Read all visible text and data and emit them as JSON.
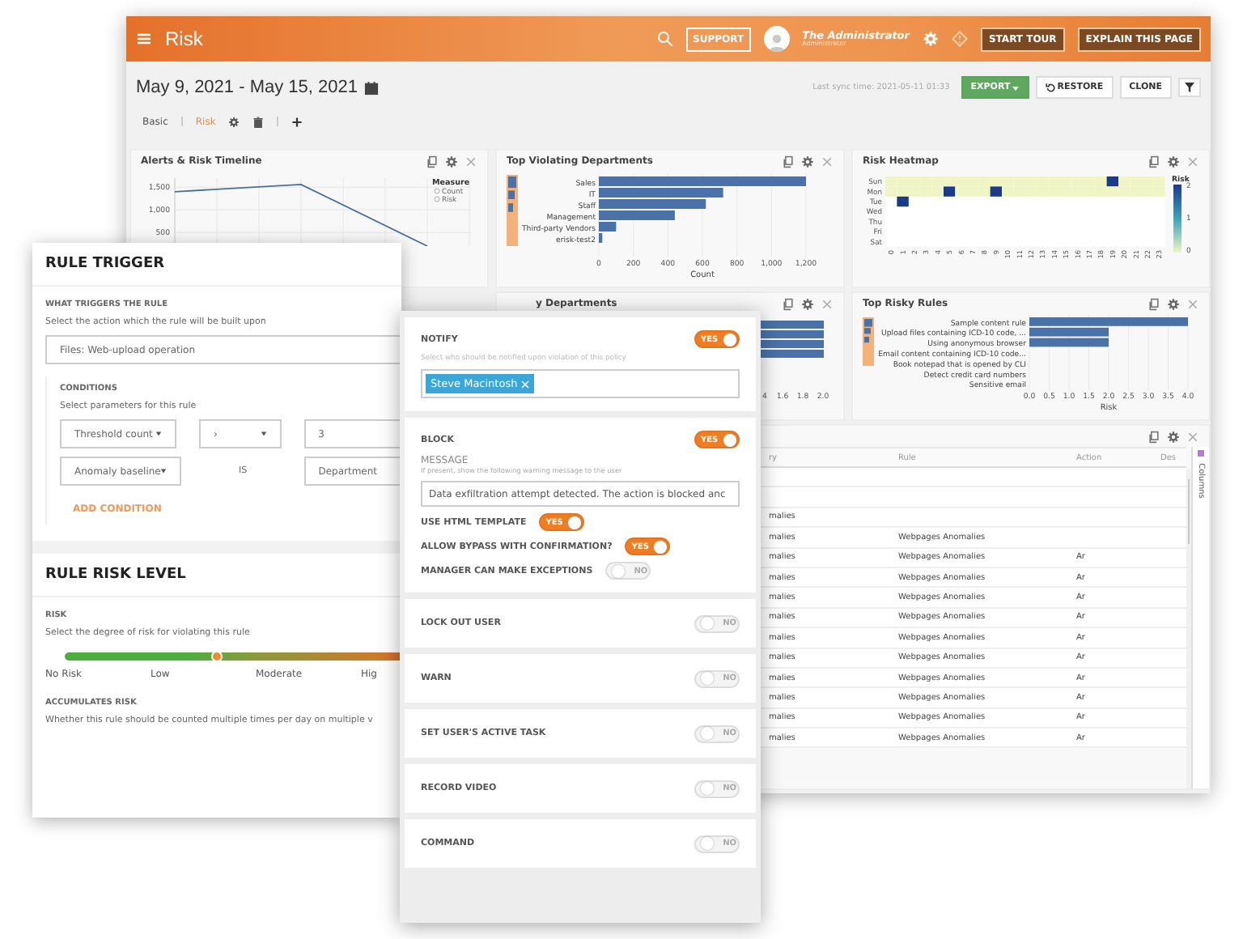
{
  "main_window": {
    "header": {
      "title": "Risk",
      "support": "SUPPORT",
      "user_name": "The Administrator",
      "user_role": "Administrator",
      "buttons": [
        "START TOUR",
        "EXPLAIN THIS PAGE"
      ]
    },
    "date_range": "May 9, 2021 - May 15, 2021",
    "last_sync": "Last sync time: 2021-05-11 01:33",
    "actions": [
      {
        "label": "EXPORT",
        "kind": "export"
      },
      {
        "label": "RESTORE",
        "kind": "restore"
      },
      {
        "label": "CLONE",
        "kind": "plain"
      }
    ],
    "tabs": [
      {
        "label": "Basic",
        "selected": false
      },
      {
        "label": "Risk",
        "selected": true
      }
    ],
    "alerts_timeline": {
      "title": "Alerts & Risk Timeline",
      "legend_title": "Measure",
      "legend": [
        "Count",
        "Risk"
      ],
      "chart_data": {
        "type": "line",
        "values": [
          1400,
          1560,
          200
        ],
        "ylim": [
          200,
          1700
        ],
        "yticks": [
          {
            "value": 500,
            "label": "500"
          },
          {
            "value": 1000,
            "label": "1,000"
          },
          {
            "value": 1500,
            "label": "1,500"
          }
        ],
        "grid": true
      }
    },
    "top_violating": {
      "title": "Top Violating Departments",
      "chart_data": {
        "type": "bar",
        "orientation": "horizontal",
        "categories": [
          "Sales",
          "IT",
          "Staff",
          "Management",
          "Third-party Vendors",
          "erisk-test2"
        ],
        "values": [
          1200,
          720,
          620,
          440,
          100,
          20
        ],
        "xlim": [
          0,
          1200
        ],
        "xticks": [
          0,
          200,
          400,
          600,
          800,
          {
            "value": 1000,
            "label": "1,000"
          },
          {
            "value": 1200,
            "label": "1,200"
          }
        ],
        "xlabel": "Count",
        "grid": true
      }
    },
    "heatmap": {
      "title": "Risk Heatmap",
      "legend_title": "Risk",
      "legend_ticks": [
        "2",
        "1",
        "0"
      ],
      "hours": [
        "0",
        "1",
        "2",
        "3",
        "4",
        "5",
        "6",
        "7",
        "8",
        "9",
        "10",
        "11",
        "12",
        "13",
        "14",
        "15",
        "16",
        "17",
        "18",
        "19",
        "20",
        "21",
        "22",
        "23"
      ],
      "rows": [
        {
          "day": "Sun",
          "cells": [
            {
              "color": "#eff6c4"
            },
            {
              "color": "#eff6c4"
            },
            {
              "color": "#eff6c4"
            },
            {
              "color": "#eff6c4"
            },
            {
              "color": "#eff6c4"
            },
            {
              "color": "#eff6c4"
            },
            {
              "color": "#eff6c4"
            },
            {
              "color": "#eff6c4"
            },
            {
              "color": "#eff6c4"
            },
            {
              "color": "#eff6c4"
            },
            {
              "color": "#eff6c4"
            },
            {
              "color": "#eff6c4"
            },
            {
              "color": "#eff6c4"
            },
            {
              "color": "#eff6c4"
            },
            {
              "color": "#eff6c4"
            },
            {
              "color": "#eff6c4"
            },
            {
              "color": "#eff6c4"
            },
            {
              "color": "#eff6c4"
            },
            {
              "color": "#eff6c4"
            },
            {
              "color": "#1b3a8a"
            },
            {
              "color": "#eff6c4"
            },
            {
              "color": "#eff6c4"
            },
            {
              "color": "#eff6c4"
            },
            {
              "color": "#eff6c4"
            }
          ]
        },
        {
          "day": "Mon",
          "cells": [
            {
              "color": "#eff6c4"
            },
            {
              "color": "#eff6c4"
            },
            {
              "color": "#eff6c4"
            },
            {
              "color": "#eff6c4"
            },
            {
              "color": "#eff6c4"
            },
            {
              "color": "#1b3a8a"
            },
            {
              "color": "#eff6c4"
            },
            {
              "color": "#eff6c4"
            },
            {
              "color": "#eff6c4"
            },
            {
              "color": "#1b3a8a"
            },
            {
              "color": "#eff6c4"
            },
            {
              "color": "#eff6c4"
            },
            {
              "color": "#eff6c4"
            },
            {
              "color": "#eff6c4"
            },
            {
              "color": "#eff6c4"
            },
            {
              "color": "#eff6c4"
            },
            {
              "color": "#eff6c4"
            },
            {
              "color": "#eff6c4"
            },
            {
              "color": "#eff6c4"
            },
            {
              "color": "#eff6c4"
            },
            {
              "color": "#eff6c4"
            },
            {
              "color": "#eff6c4"
            },
            {
              "color": "#eff6c4"
            },
            {
              "color": "#eff6c4"
            }
          ]
        },
        {
          "day": "Tue",
          "cells": [
            null,
            {
              "color": "#1b3a8a"
            },
            null,
            null,
            null,
            null,
            null,
            null,
            null,
            null,
            null,
            null,
            null,
            null,
            null,
            null,
            null,
            null,
            null,
            null,
            null,
            null,
            null,
            null
          ]
        },
        {
          "day": "Wed",
          "cells": [
            null,
            null,
            null,
            null,
            null,
            null,
            null,
            null,
            null,
            null,
            null,
            null,
            null,
            null,
            null,
            null,
            null,
            null,
            null,
            null,
            null,
            null,
            null,
            null
          ]
        },
        {
          "day": "Thu",
          "cells": [
            null,
            null,
            null,
            null,
            null,
            null,
            null,
            null,
            null,
            null,
            null,
            null,
            null,
            null,
            null,
            null,
            null,
            null,
            null,
            null,
            null,
            null,
            null,
            null
          ]
        },
        {
          "day": "Fri",
          "cells": [
            null,
            null,
            null,
            null,
            null,
            null,
            null,
            null,
            null,
            null,
            null,
            null,
            null,
            null,
            null,
            null,
            null,
            null,
            null,
            null,
            null,
            null,
            null,
            null
          ]
        },
        {
          "day": "Sat",
          "cells": [
            null,
            null,
            null,
            null,
            null,
            null,
            null,
            null,
            null,
            null,
            null,
            null,
            null,
            null,
            null,
            null,
            null,
            null,
            null,
            null,
            null,
            null,
            null,
            null
          ]
        }
      ]
    },
    "risky_departments": {
      "title": "y Departments",
      "tick_labels": [
        "4",
        "1.6",
        "1.8",
        "2.0"
      ]
    },
    "risky_rules": {
      "title": "Top Risky Rules",
      "chart_data": {
        "type": "bar",
        "orientation": "horizontal",
        "categories": [
          "Sample content rule",
          "Upload files containing ICD-10 code, ...",
          "Using anonymous browser",
          "Email content containing ICD-10 code...",
          "Book notepad that is opened by CLI",
          "Detect credit card numbers",
          "Sensitive email"
        ],
        "values": [
          4,
          2,
          2,
          0,
          0,
          0,
          0
        ],
        "xlim": [
          0,
          4
        ],
        "xticks": [
          {
            "value": 0,
            "label": "0.0"
          },
          0.5,
          {
            "value": 1,
            "label": "1.0"
          },
          1.5,
          {
            "value": 2,
            "label": "2.0"
          },
          2.5,
          {
            "value": 3,
            "label": "3.0"
          },
          3.5,
          {
            "value": 4,
            "label": "4.0"
          }
        ],
        "xlabel": "Risk",
        "grid": true
      }
    },
    "table": {
      "columns": [
        "ry",
        "Rule",
        "Action",
        "Des"
      ],
      "side_tab": "Columns",
      "rows": [
        {
          "cells": []
        },
        {
          "cells": []
        },
        {
          "cells": [
            "malies"
          ]
        },
        {
          "cells": [
            "malies",
            "Webpages Anomalies"
          ]
        },
        {
          "cells": [
            "malies",
            "Webpages Anomalies",
            "Ar"
          ]
        },
        {
          "cells": [
            "malies",
            "Webpages Anomalies",
            "Ar"
          ]
        },
        {
          "cells": [
            "malies",
            "Webpages Anomalies",
            "Ar"
          ]
        },
        {
          "cells": [
            "malies",
            "Webpages Anomalies",
            "Ar"
          ]
        },
        {
          "cells": [
            "malies",
            "Webpages Anomalies",
            "Ar"
          ]
        },
        {
          "cells": [
            "malies",
            "Webpages Anomalies",
            "Ar"
          ]
        },
        {
          "cells": [
            "malies",
            "Webpages Anomalies",
            "Ar"
          ]
        },
        {
          "cells": [
            "malies",
            "Webpages Anomalies",
            "Ar"
          ]
        },
        {
          "cells": [
            "malies",
            "Webpages Anomalies",
            "Ar"
          ]
        },
        {
          "cells": [
            "malies",
            "Webpages Anomalies",
            "Ar"
          ]
        }
      ]
    }
  },
  "rule_panel": {
    "trigger_title": "RULE TRIGGER",
    "what_label": "WHAT TRIGGERS THE RULE",
    "what_hint": "Select the action which the rule will be built upon",
    "action_select": "Files: Web-upload operation",
    "conditions_label": "CONDITIONS",
    "conditions_hint": "Select parameters for this rule",
    "condition_rows": [
      {
        "field": "Threshold count",
        "operator": "›",
        "value": "3"
      },
      {
        "field": "Anomaly baseline",
        "operator": "IS",
        "value": "Department"
      }
    ],
    "add_condition": "ADD CONDITION",
    "risk_title": "RULE RISK LEVEL",
    "risk_label": "RISK",
    "risk_hint": "Select the degree of risk for violating this rule",
    "risk": {
      "level": 0.36,
      "labels": [
        "No Risk",
        "Low",
        "Moderate",
        "Hig"
      ]
    },
    "accumulates_label": "ACCUMULATES RISK",
    "accumulates_hint": "Whether this rule should be counted multiple times per day on multiple v"
  },
  "actions_panel": {
    "notify": {
      "label": "NOTIFY",
      "on": true,
      "toggle": "YES",
      "hint": "Select who should be notified upon violation of this policy",
      "recipients": [
        "Steve Macintosh"
      ]
    },
    "block": {
      "label": "BLOCK",
      "on": true,
      "toggle": "YES",
      "message_label": "MESSAGE",
      "message_hint": "If present, show the following warning message to the user",
      "message": "Data exfiltration attempt detected. The action is blocked anc",
      "options": [
        {
          "label": "USE HTML TEMPLATE",
          "on": true,
          "toggle": "YES"
        },
        {
          "label": "ALLOW BYPASS WITH CONFIRMATION?",
          "on": true,
          "toggle": "YES"
        },
        {
          "label": "MANAGER CAN MAKE EXCEPTIONS",
          "on": false,
          "toggle": "NO"
        }
      ]
    },
    "sections": [
      {
        "label": "LOCK OUT USER",
        "on": false,
        "toggle": "NO"
      },
      {
        "label": "WARN",
        "on": false,
        "toggle": "NO"
      },
      {
        "label": "SET USER'S ACTIVE TASK",
        "on": false,
        "toggle": "NO"
      },
      {
        "label": "RECORD VIDEO",
        "on": false,
        "toggle": "NO"
      },
      {
        "label": "COMMAND",
        "on": false,
        "toggle": "NO"
      }
    ]
  }
}
